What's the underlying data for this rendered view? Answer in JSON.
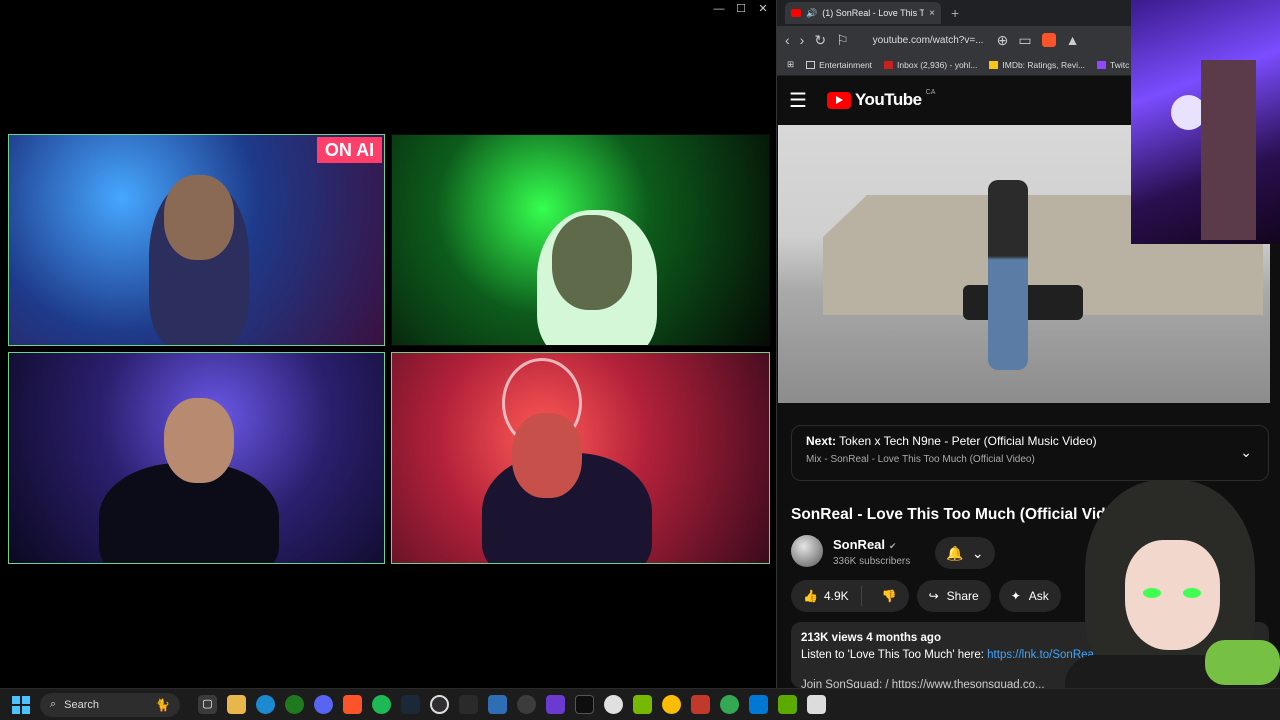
{
  "call_window": {
    "controls": [
      "—",
      "☐",
      "✕"
    ],
    "tiles": [
      "participant-1",
      "participant-2",
      "participant-3",
      "participant-4"
    ],
    "sign_text": "ON AI"
  },
  "browser": {
    "tab": {
      "title": "(1) SonReal - Love This Too M",
      "close": "×"
    },
    "new_tab": "+",
    "url": "youtube.com/watch?v=...",
    "bookmarks": [
      {
        "label": "Entertainment",
        "icon": "folder-icon"
      },
      {
        "label": "Inbox (2,936) - yohl...",
        "icon": "gmail-icon"
      },
      {
        "label": "IMDb: Ratings, Revi...",
        "icon": "imdb-icon"
      },
      {
        "label": "Twitc",
        "icon": "twitch-icon"
      }
    ]
  },
  "youtube": {
    "logo": "YouTube",
    "region": "CA",
    "up_next": {
      "label": "Next:",
      "title": "Token x Tech N9ne - Peter (Official Music Video)",
      "subtitle": "Mix - SonReal - Love This Too Much (Official Video)"
    },
    "video_title": "SonReal - Love This Too Much (Official Video",
    "channel": {
      "name": "SonReal",
      "subscribers": "336K subscribers"
    },
    "actions": {
      "likes": "4.9K",
      "share": "Share",
      "ask": "Ask"
    },
    "description": {
      "meta": "213K views  4 months ago",
      "text": "Listen to 'Love This Too Much' here: ",
      "link": "https://lnk.to/SonRea",
      "partial": "Join SonSquad: / https://www.thesonsquad.co..."
    }
  },
  "taskbar": {
    "search_label": "Search",
    "apps": [
      "task-view",
      "file-explorer",
      "edge",
      "xbox",
      "discord",
      "brave",
      "spotify",
      "steam",
      "obs",
      "epic",
      "notepad",
      "steam-alt",
      "clapper",
      "terminal",
      "steelseries",
      "nvidia",
      "chrome",
      "vortex",
      "chrome-alt",
      "vscode",
      "nvidia-alt",
      "notes"
    ]
  },
  "colors": {
    "accent": "#3ea6ff",
    "youtube_red": "#ff0000",
    "tile_border": "#6fd38b"
  }
}
